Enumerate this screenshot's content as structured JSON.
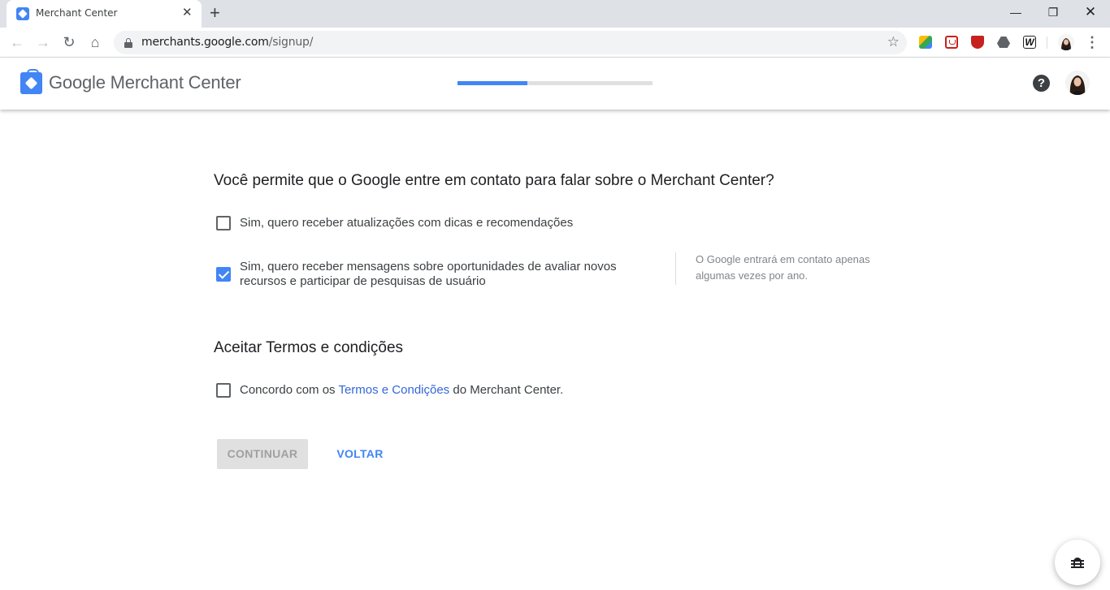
{
  "browser": {
    "tab_title": "Merchant Center",
    "url_host": "merchants.google.com",
    "url_path": "/signup/"
  },
  "header": {
    "logo_text": "Google Merchant Center",
    "progress_fraction": 0.36
  },
  "contact_section": {
    "heading": "Você permite que o Google entre em contato para falar sobre o Merchant Center?",
    "options": [
      {
        "label": "Sim, quero receber atualizações com dicas e recomendações",
        "checked": false
      },
      {
        "label": "Sim, quero receber mensagens sobre oportunidades de avaliar novos recursos e participar de pesquisas de usuário",
        "checked": true
      }
    ],
    "side_note": "O Google entrará em contato apenas algumas vezes por ano."
  },
  "terms_section": {
    "heading": "Aceitar Termos e condições",
    "agree_prefix": "Concordo com os ",
    "agree_link": "Termos e Condições",
    "agree_suffix": " do Merchant Center.",
    "checked": false
  },
  "actions": {
    "continue_label": "CONTINUAR",
    "back_label": "VOLTAR"
  },
  "colors": {
    "accent": "#4285f4",
    "link": "#3367d6"
  }
}
